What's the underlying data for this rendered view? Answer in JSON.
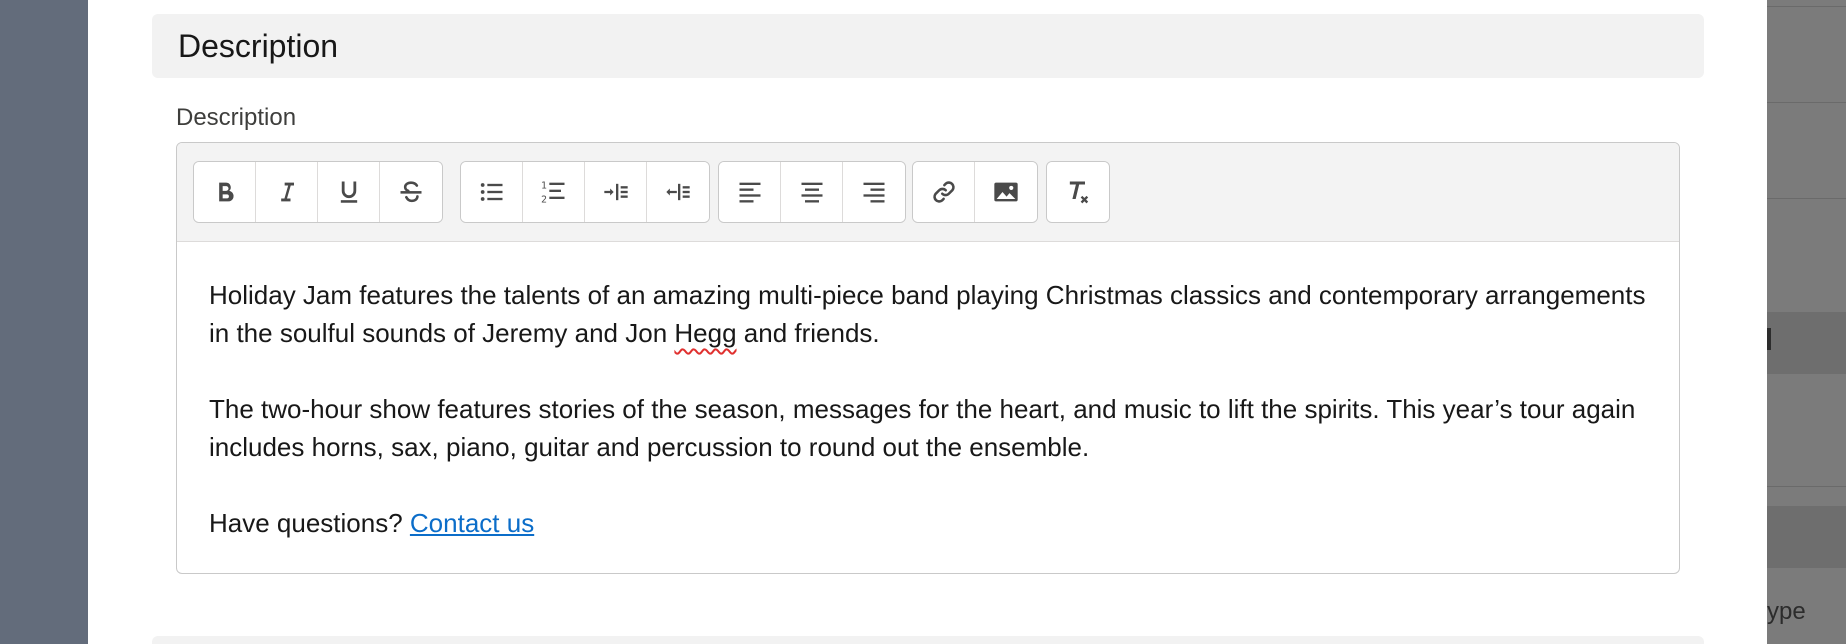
{
  "section": {
    "title": "Description"
  },
  "field": {
    "label": "Description"
  },
  "toolbar": {
    "groups": [
      [
        {
          "name": "bold-icon",
          "title": "Bold"
        },
        {
          "name": "italic-icon",
          "title": "Italic"
        },
        {
          "name": "underline-icon",
          "title": "Underline"
        },
        {
          "name": "strikethrough-icon",
          "title": "Strikethrough"
        }
      ],
      [
        {
          "name": "bulleted-list-icon",
          "title": "Bulleted list"
        },
        {
          "name": "numbered-list-icon",
          "title": "Numbered list"
        },
        {
          "name": "indent-icon",
          "title": "Indent"
        },
        {
          "name": "outdent-icon",
          "title": "Outdent"
        }
      ],
      [
        {
          "name": "align-left-icon",
          "title": "Align left"
        },
        {
          "name": "align-center-icon",
          "title": "Align center"
        },
        {
          "name": "align-right-icon",
          "title": "Align right"
        }
      ],
      [
        {
          "name": "link-icon",
          "title": "Link"
        },
        {
          "name": "image-icon",
          "title": "Image"
        }
      ],
      [
        {
          "name": "clear-formatting-icon",
          "title": "Remove formatting"
        }
      ]
    ]
  },
  "body": {
    "p1_before": "Holiday Jam features the talents of an amazing multi-piece band playing Christmas classics and contemporary arrangements in the soulful sounds of Jeremy and Jon ",
    "p1_misspelled": "Hegg",
    "p1_after": " and friends.",
    "p2": "The two-hour show features stories of the season, messages for the heart, and music to lift the spirits. This year’s tour again includes horns, sax, piano, guitar and percussion to round out the ensemble.",
    "p3_prefix": "Have questions? ",
    "p3_link": "Contact us"
  },
  "background": {
    "partial_text": "ype"
  },
  "colors": {
    "link": "#0b6dc9",
    "spellcheck": "#e0302f",
    "toolbar_bg": "#f3f3f3",
    "section_bg": "#f2f2f2"
  }
}
